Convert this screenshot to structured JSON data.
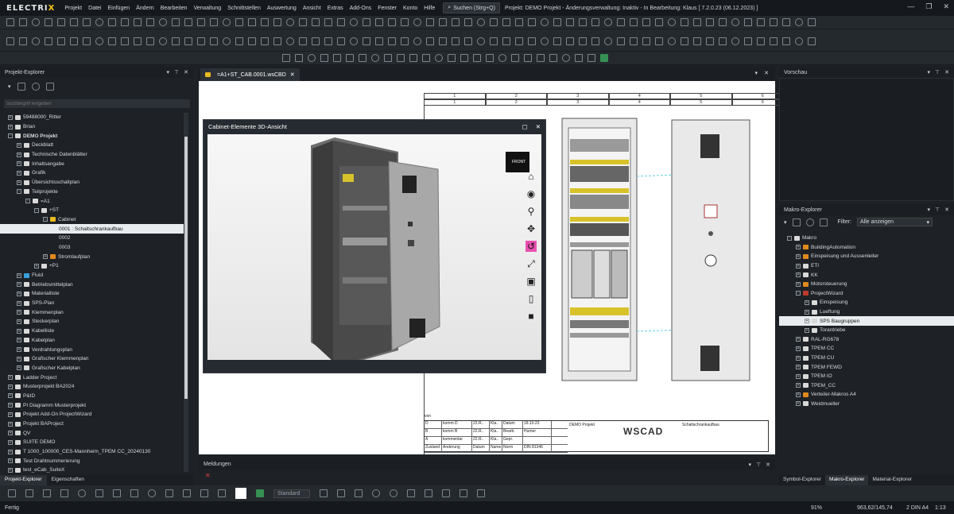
{
  "app": {
    "logo_a": "ELECTRI",
    "logo_b": "X"
  },
  "menu": [
    "Projekt",
    "Datei",
    "Einfügen",
    "Ändern",
    "Bearbeiten",
    "Verwaltung",
    "Schnittstellen",
    "Auswertung",
    "Ansicht",
    "Extras",
    "Add-Ons",
    "Fenster",
    "Konto",
    "Hilfe"
  ],
  "search": {
    "label": "Suchen (Strg+Q)"
  },
  "project_status": "Projekt: DEMO Projekt - Änderungsverwaltung: Inaktiv - In Bearbeitung: Klaus [ 7.2.0.23 (06.12.2023) ]",
  "left_panel": {
    "title": "Projekt-Explorer",
    "search_placeholder": "Suchbegriff eingeben",
    "tree": [
      {
        "label": "59488000_Ritter",
        "indent": 0,
        "pm": "+",
        "icon": "folder"
      },
      {
        "label": "Brian",
        "indent": 0,
        "pm": "+",
        "icon": "folder"
      },
      {
        "label": "DEMO Projekt",
        "indent": 0,
        "pm": "-",
        "icon": "folder",
        "bold": true
      },
      {
        "label": "Deckblatt",
        "indent": 1,
        "pm": "+",
        "icon": "folder"
      },
      {
        "label": "Technische Datenblätter",
        "indent": 1,
        "pm": "+",
        "icon": "folder"
      },
      {
        "label": "Inhaltsangabe",
        "indent": 1,
        "pm": "+",
        "icon": "folder"
      },
      {
        "label": "Grafik",
        "indent": 1,
        "pm": "+",
        "icon": "folder"
      },
      {
        "label": "Übersichtsschaltplan",
        "indent": 1,
        "pm": "+",
        "icon": "folder"
      },
      {
        "label": "Teilprojekte",
        "indent": 1,
        "pm": "-",
        "icon": "folder"
      },
      {
        "label": "=A1",
        "indent": 2,
        "pm": "-",
        "icon": "folder"
      },
      {
        "label": "+ST",
        "indent": 3,
        "pm": "-",
        "icon": "folder"
      },
      {
        "label": "Cabinet",
        "indent": 4,
        "pm": "-",
        "icon": "yellow"
      },
      {
        "label": "0001 : Schaltschrankaufbau",
        "indent": 5,
        "pm": "",
        "icon": "",
        "selected": true
      },
      {
        "label": "0002",
        "indent": 5,
        "pm": "",
        "icon": ""
      },
      {
        "label": "0003",
        "indent": 5,
        "pm": "",
        "icon": ""
      },
      {
        "label": "Stromlaufplan",
        "indent": 4,
        "pm": "+",
        "icon": "orange"
      },
      {
        "label": "+P1",
        "indent": 3,
        "pm": "+",
        "icon": "folder"
      },
      {
        "label": "Fluid",
        "indent": 1,
        "pm": "+",
        "icon": "blue"
      },
      {
        "label": "Betriebsmittelplan",
        "indent": 1,
        "pm": "+",
        "icon": "folder"
      },
      {
        "label": "Materialliste",
        "indent": 1,
        "pm": "+",
        "icon": "folder"
      },
      {
        "label": "SPS-Plan",
        "indent": 1,
        "pm": "+",
        "icon": "folder"
      },
      {
        "label": "Klemmenplan",
        "indent": 1,
        "pm": "+",
        "icon": "folder"
      },
      {
        "label": "Steckerplan",
        "indent": 1,
        "pm": "+",
        "icon": "folder"
      },
      {
        "label": "Kabelliste",
        "indent": 1,
        "pm": "+",
        "icon": "folder"
      },
      {
        "label": "Kabelplan",
        "indent": 1,
        "pm": "+",
        "icon": "folder"
      },
      {
        "label": "Verdrahtungsplan",
        "indent": 1,
        "pm": "+",
        "icon": "folder"
      },
      {
        "label": "Grafischer Klemmenplan",
        "indent": 1,
        "pm": "+",
        "icon": "folder"
      },
      {
        "label": "Grafischer Kabelplan",
        "indent": 1,
        "pm": "+",
        "icon": "folder"
      },
      {
        "label": "Ladder Project",
        "indent": 0,
        "pm": "+",
        "icon": "folder"
      },
      {
        "label": "Musterprojekt BA2024",
        "indent": 0,
        "pm": "+",
        "icon": "folder"
      },
      {
        "label": "P&ID",
        "indent": 0,
        "pm": "+",
        "icon": "folder"
      },
      {
        "label": "PI Diagramm Musterprojekt",
        "indent": 0,
        "pm": "+",
        "icon": "folder"
      },
      {
        "label": "Projekt Add-On ProjectWizard",
        "indent": 0,
        "pm": "+",
        "icon": "folder"
      },
      {
        "label": "Projekt BAProject",
        "indent": 0,
        "pm": "+",
        "icon": "folder"
      },
      {
        "label": "QV",
        "indent": 0,
        "pm": "+",
        "icon": "folder"
      },
      {
        "label": "SUITE DEMO",
        "indent": 0,
        "pm": "+",
        "icon": "folder"
      },
      {
        "label": "T 1000_100000_CES-Mannheim_TPEM CC_20240130",
        "indent": 0,
        "pm": "+",
        "icon": "folder"
      },
      {
        "label": "Test Drahtnummerierung",
        "indent": 0,
        "pm": "+",
        "icon": "folder"
      },
      {
        "label": "test_eCab_SuiteX",
        "indent": 0,
        "pm": "+",
        "icon": "folder"
      }
    ],
    "bottom_tabs": [
      "Projekt-Explorer",
      "Eigenschaften"
    ]
  },
  "document": {
    "tab_label": "=A1+ST_CAB.0001.wsCBD",
    "frame_cols": [
      "1",
      "2",
      "3",
      "4",
      "5",
      "6"
    ],
    "view3d_title": "Cabinet-Elemente 3D-Ansicht",
    "front_label": "FRONT",
    "title_block": {
      "von": "von",
      "rows": [
        [
          "D",
          "komm D",
          "22.R..",
          "Kla..",
          "Datum",
          "18.10.23"
        ],
        [
          "B",
          "komm B",
          "22.R..",
          "Kla..",
          "Bearb.",
          "Humer"
        ],
        [
          "A",
          "kommentar",
          "22.R..",
          "Kla..",
          "Gepr.",
          ""
        ],
        [
          "Zustand",
          "Änderung",
          "Datum",
          "Name",
          "Norm",
          "DIN 81346"
        ]
      ],
      "project": "DEMO Projekt",
      "logo": "WSCAD",
      "drawing": "Schaltschrankaufbau"
    }
  },
  "messages": {
    "title": "Meldungen"
  },
  "right_panel": {
    "preview_title": "Vorschau",
    "macro_title": "Makro-Explorer",
    "filter_label": "Filter:",
    "filter_value": "Alle anzeigen",
    "tree": [
      {
        "label": "Makro",
        "indent": 0,
        "pm": "-",
        "icon": "folder"
      },
      {
        "label": "BuildingAutomation",
        "indent": 1,
        "pm": "+",
        "icon": "orange"
      },
      {
        "label": "Einspeisung und Aussenleiter",
        "indent": 1,
        "pm": "+",
        "icon": "orange"
      },
      {
        "label": "ETI",
        "indent": 1,
        "pm": "+",
        "icon": "folder"
      },
      {
        "label": "KK",
        "indent": 1,
        "pm": "+",
        "icon": "folder"
      },
      {
        "label": "Motorsteuerung",
        "indent": 1,
        "pm": "+",
        "icon": "orange"
      },
      {
        "label": "ProjectWizard",
        "indent": 1,
        "pm": "-",
        "icon": "red"
      },
      {
        "label": "Einspeisung",
        "indent": 2,
        "pm": "+",
        "icon": "folder"
      },
      {
        "label": "Lueftung",
        "indent": 2,
        "pm": "+",
        "icon": "folder"
      },
      {
        "label": "SPS Baugruppen",
        "indent": 2,
        "pm": "+",
        "icon": "folder",
        "selected": true
      },
      {
        "label": "Torantriebe",
        "indent": 2,
        "pm": "+",
        "icon": "folder"
      },
      {
        "label": "RAL-RG678",
        "indent": 1,
        "pm": "+",
        "icon": "folder"
      },
      {
        "label": "TPEM CC",
        "indent": 1,
        "pm": "+",
        "icon": "folder"
      },
      {
        "label": "TPEM CU",
        "indent": 1,
        "pm": "+",
        "icon": "folder"
      },
      {
        "label": "TPEM FEWD",
        "indent": 1,
        "pm": "+",
        "icon": "folder"
      },
      {
        "label": "TPEM IO",
        "indent": 1,
        "pm": "+",
        "icon": "folder"
      },
      {
        "label": "TPEM_CC",
        "indent": 1,
        "pm": "+",
        "icon": "folder"
      },
      {
        "label": "Verteiler-Makros A4",
        "indent": 1,
        "pm": "+",
        "icon": "orange"
      },
      {
        "label": "Weidmueller",
        "indent": 1,
        "pm": "+",
        "icon": "folder"
      }
    ],
    "bottom_tabs": [
      "Symbol-Explorer",
      "Makro-Explorer",
      "Material-Explorer"
    ]
  },
  "drawbar": {
    "style_value": "Standard"
  },
  "status": {
    "left": "Fertig",
    "zoom": "91%",
    "coords": "963,62/145,74",
    "sheet": "2 DIN A4",
    "scale": "1:13"
  },
  "colors": {
    "accent": "#f5c518",
    "selection": "#e9ecef",
    "rotate_active": "#e94fb0"
  }
}
